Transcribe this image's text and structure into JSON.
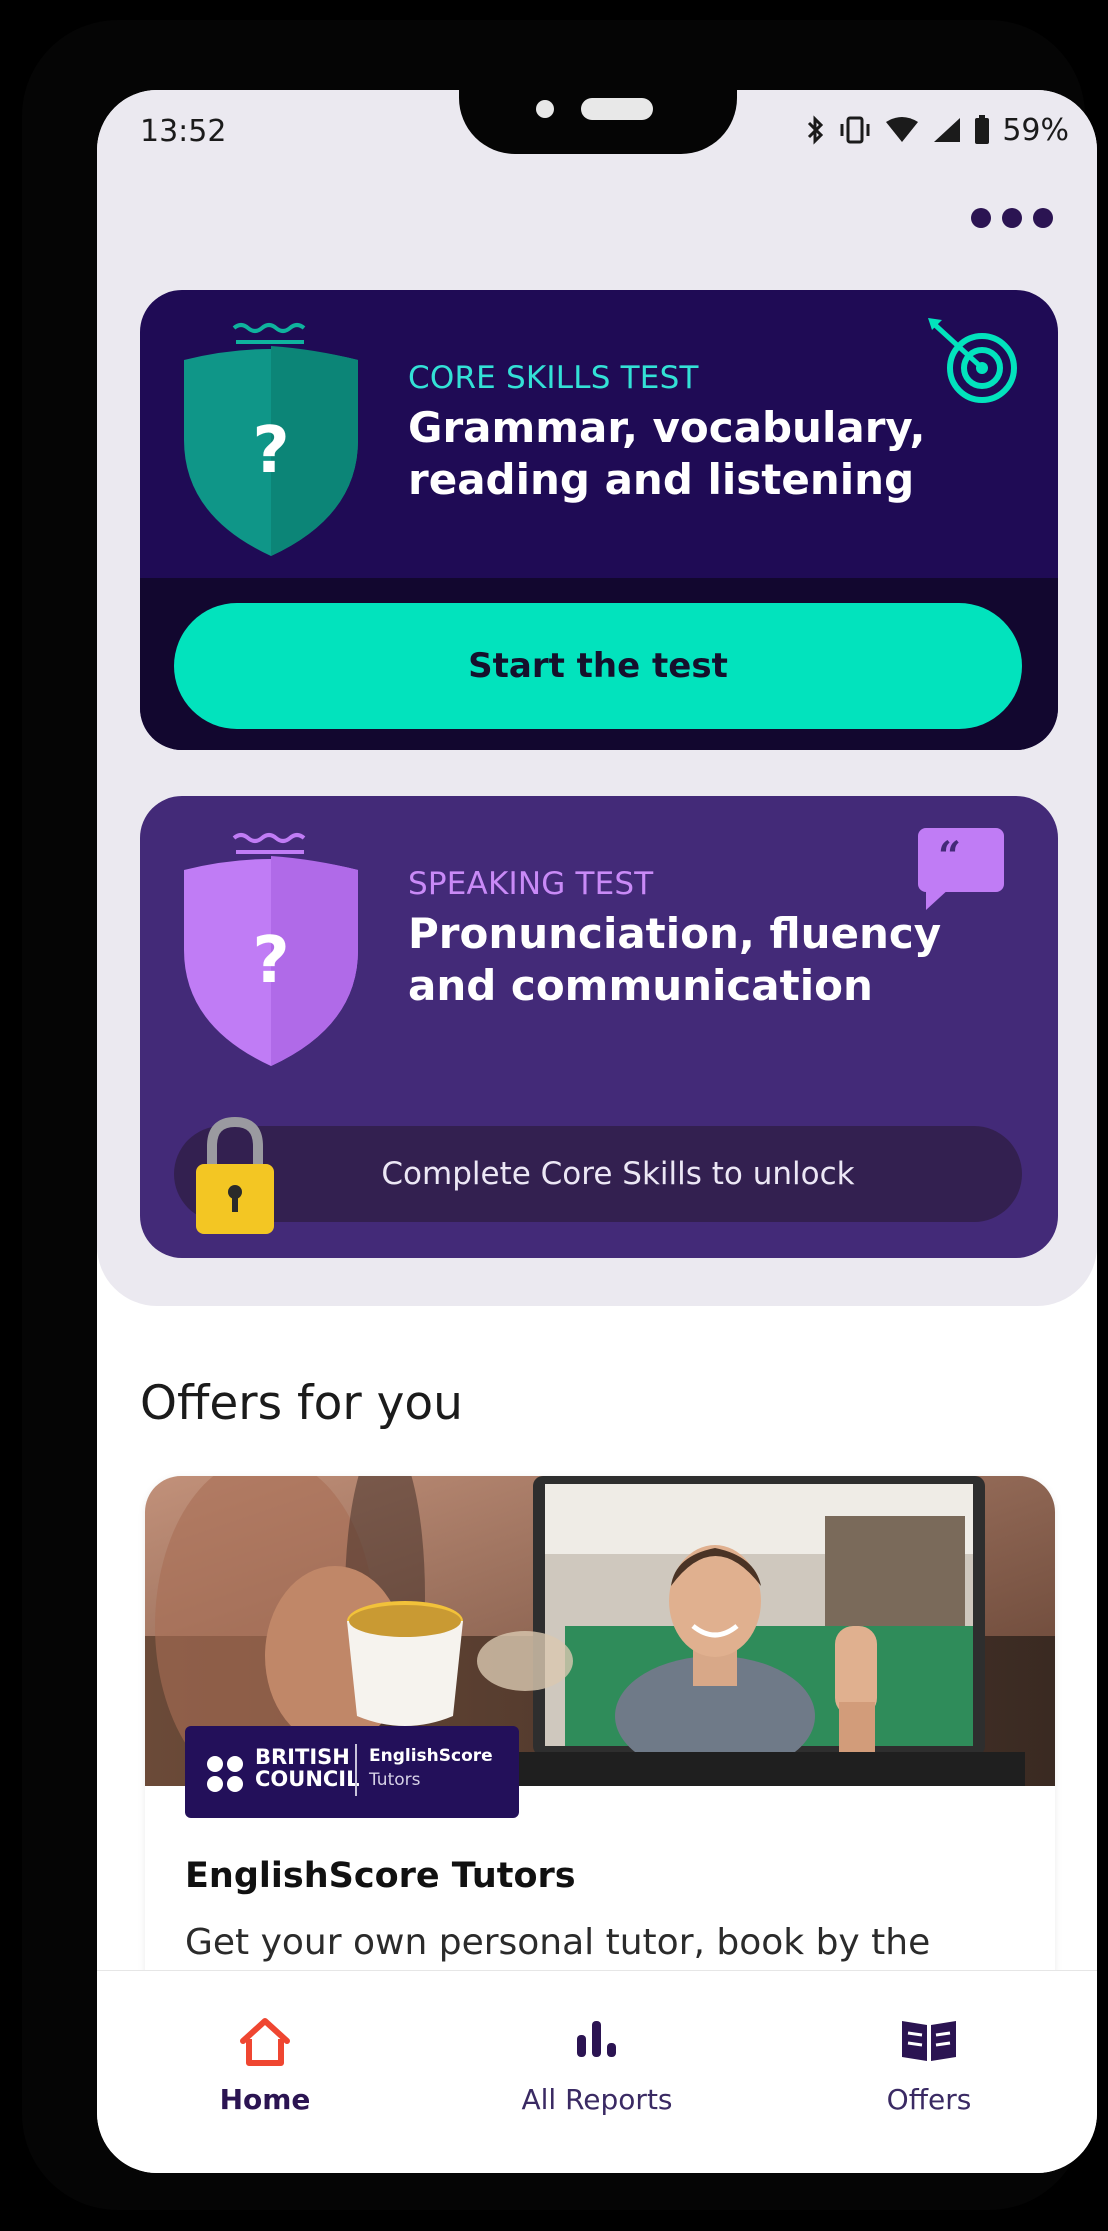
{
  "status_bar": {
    "time": "13:52",
    "battery": "59%",
    "icons": [
      "bluetooth-icon",
      "vibrate-icon",
      "wifi-icon",
      "signal-icon",
      "battery-icon"
    ]
  },
  "menu": {
    "icon": "more-dots-icon"
  },
  "core_card": {
    "eyebrow": "CORE SKILLS TEST",
    "title": "Grammar, vocabulary, reading and listening",
    "shield_symbol": "?",
    "corner_icon": "target-icon",
    "button_label": "Start the test",
    "colors": {
      "bg": "#1f0b55",
      "accent": "#02e3bd",
      "shield": "#0f9688"
    }
  },
  "speaking_card": {
    "eyebrow": "SPEAKING TEST",
    "title": "Pronunciation, fluency and communication",
    "shield_symbol": "?",
    "corner_icon": "quote-bubble-icon",
    "lock_text": "Complete Core Skills to unlock",
    "colors": {
      "bg": "#432a78",
      "accent": "#c07cf5",
      "lock": "#f3c623"
    }
  },
  "offers": {
    "section_title": "Offers for you",
    "card": {
      "brand_line1": "BRITISH",
      "brand_line2": "COUNCIL",
      "brand_product": "EnglishScore",
      "brand_sub": "Tutors",
      "title": "EnglishScore Tutors",
      "description": "Get your own personal tutor, book by the"
    }
  },
  "bottom_nav": {
    "items": [
      {
        "label": "Home",
        "icon": "home-icon",
        "active": true
      },
      {
        "label": "All Reports",
        "icon": "bar-chart-icon",
        "active": false
      },
      {
        "label": "Offers",
        "icon": "book-icon",
        "active": false
      }
    ],
    "colors": {
      "active_text": "#2b1452",
      "inactive_text": "#3a2a63",
      "home_icon": "#ef4631"
    }
  }
}
